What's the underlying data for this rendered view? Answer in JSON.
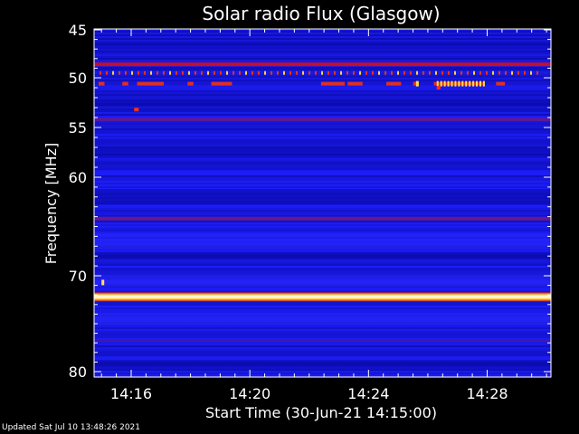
{
  "chart_data": {
    "type": "heatmap",
    "title": "Solar radio Flux (Glasgow)",
    "xlabel": "Start Time (30-Jun-21 14:15:00)",
    "ylabel": "Frequency [MHz]",
    "y_range": [
      45,
      80
    ],
    "y_ticks": [
      {
        "value": 45,
        "label": "45"
      },
      {
        "value": 50,
        "label": "50"
      },
      {
        "value": 55,
        "label": "55"
      },
      {
        "value": 60,
        "label": "60"
      },
      {
        "value": 70,
        "label": "70"
      },
      {
        "value": 80,
        "label": "80"
      }
    ],
    "x_range_minutes": [
      14.75,
      30.15
    ],
    "x_ticks": [
      {
        "value": 16,
        "label": "14:16"
      },
      {
        "value": 20,
        "label": "14:20"
      },
      {
        "value": 24,
        "label": "14:24"
      },
      {
        "value": 28,
        "label": "14:28"
      }
    ],
    "background_color": "#1a1ae8",
    "emission_lines": [
      {
        "freq_mhz": 48.6,
        "intensity": "high",
        "color": "#c0102a"
      },
      {
        "freq_mhz": 49.5,
        "intensity": "intermittent",
        "color": "#e83010"
      },
      {
        "freq_mhz": 50.6,
        "intensity": "intermittent",
        "color": "#e03020"
      },
      {
        "freq_mhz": 54.2,
        "intensity": "medium",
        "color": "#6a1a90"
      },
      {
        "freq_mhz": 64.2,
        "intensity": "medium",
        "color": "#7a1a80"
      },
      {
        "freq_mhz": 72.2,
        "intensity": "very_high",
        "color": "#fff8b0"
      },
      {
        "freq_mhz": 76.8,
        "intensity": "low",
        "color": "#5a1aa0"
      }
    ],
    "grid": false
  },
  "footer": {
    "updated": "Updated Sat Jul 10 13:48:26 2021"
  }
}
